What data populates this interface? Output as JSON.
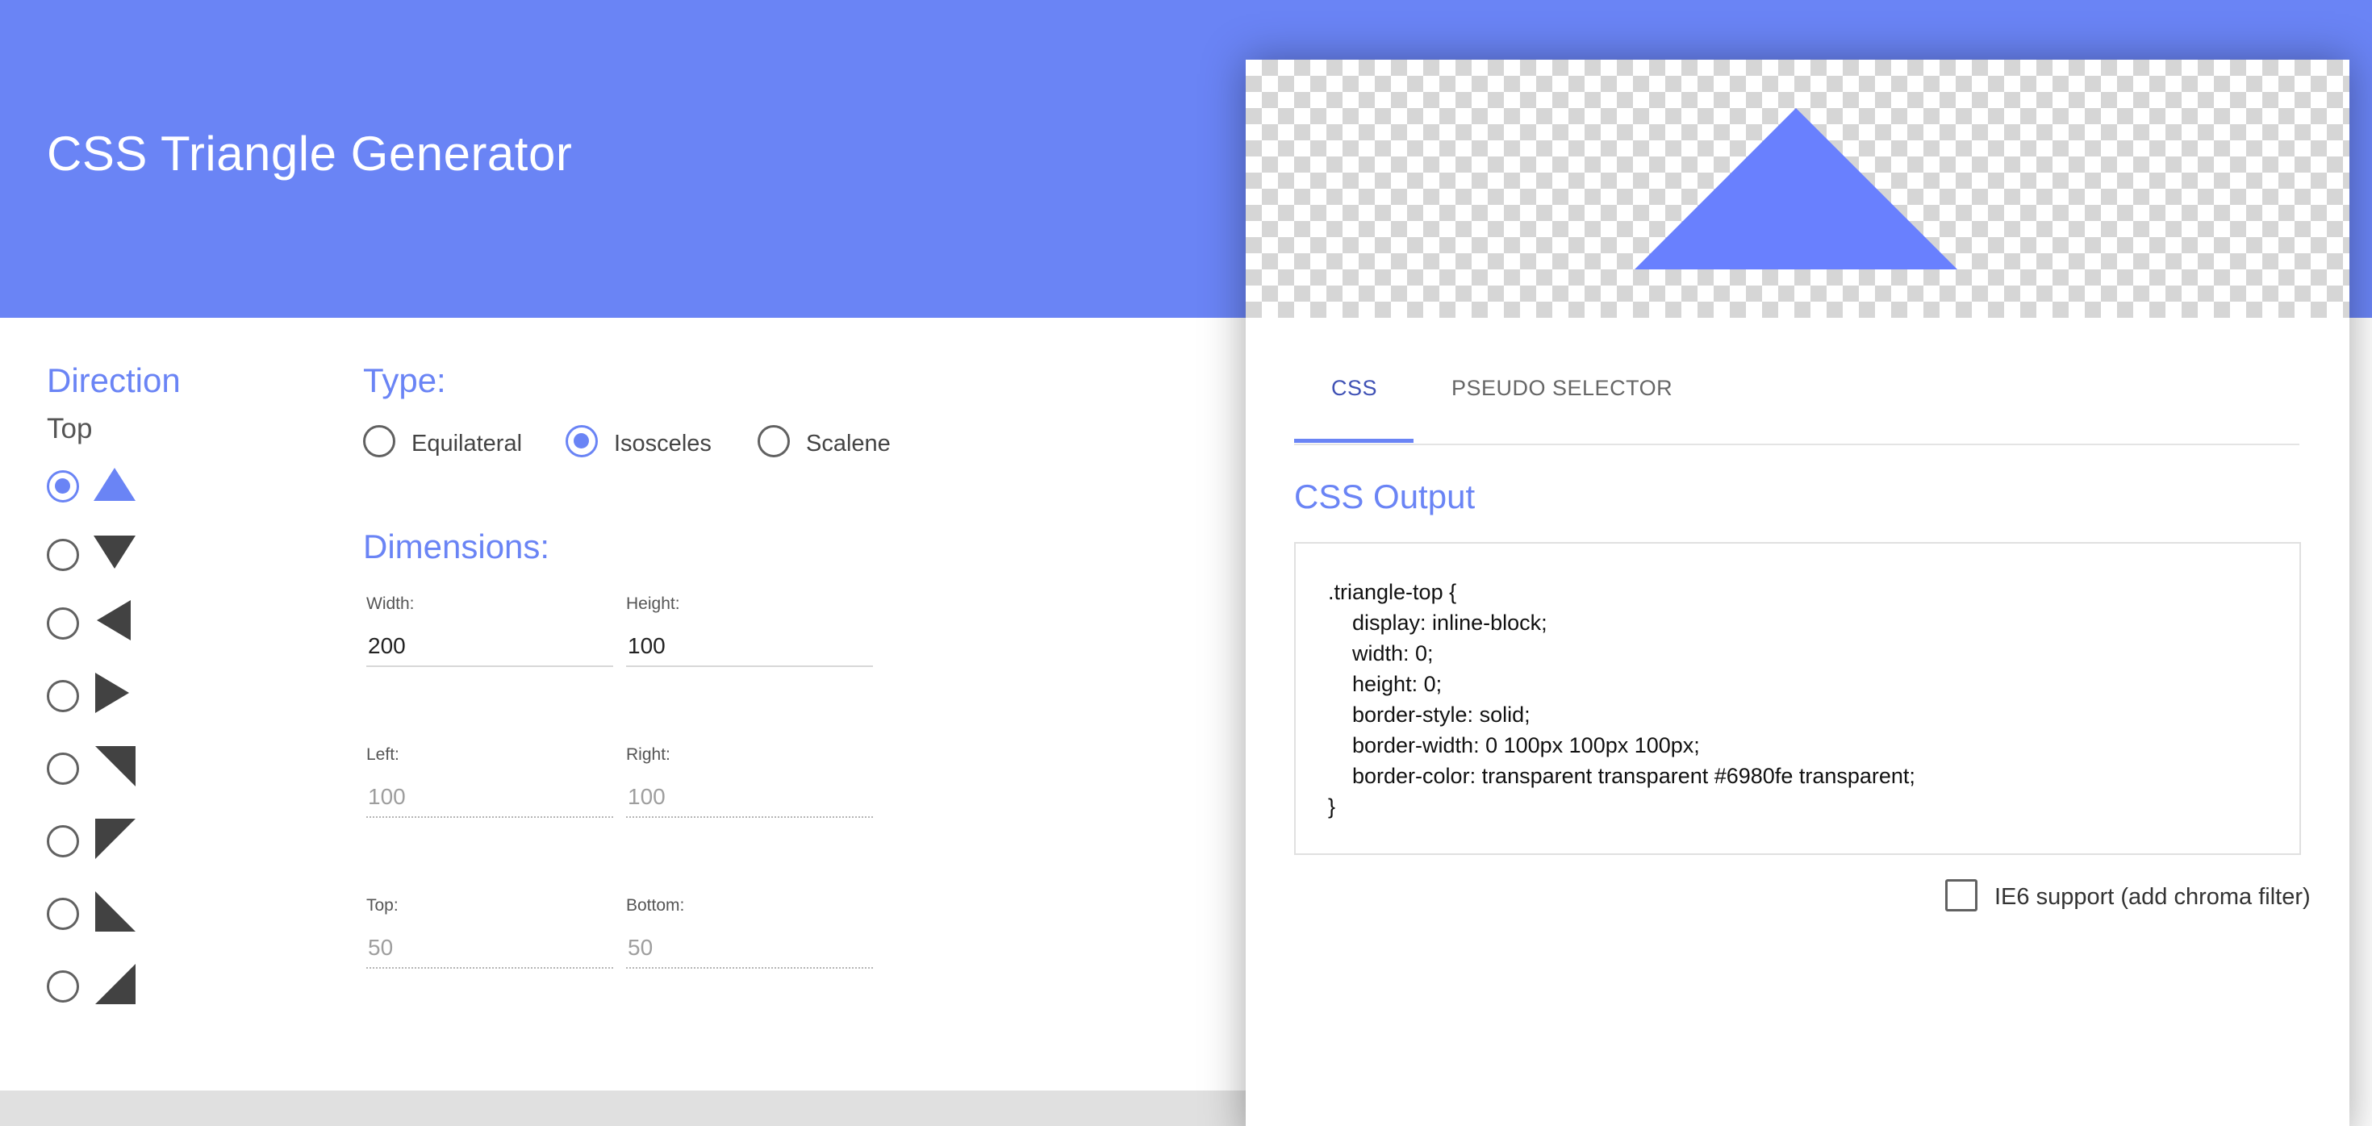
{
  "app": {
    "title": "CSS Triangle Generator",
    "accent_color": "#6a84f5",
    "triangle_color": "#6980fe"
  },
  "direction": {
    "heading": "Direction",
    "selected_value": "Top",
    "options": [
      {
        "name": "top",
        "icon": "triangle-up-icon",
        "selected": true
      },
      {
        "name": "bottom",
        "icon": "triangle-down-icon",
        "selected": false
      },
      {
        "name": "left",
        "icon": "triangle-left-icon",
        "selected": false
      },
      {
        "name": "right",
        "icon": "triangle-right-icon",
        "selected": false
      },
      {
        "name": "top-right",
        "icon": "triangle-top-right-icon",
        "selected": false
      },
      {
        "name": "top-left",
        "icon": "triangle-top-left-icon",
        "selected": false
      },
      {
        "name": "bottom-left",
        "icon": "triangle-bottom-left-icon",
        "selected": false
      },
      {
        "name": "bottom-right",
        "icon": "triangle-bottom-right-icon",
        "selected": false
      }
    ]
  },
  "type": {
    "heading": "Type:",
    "options": [
      {
        "label": "Equilateral",
        "selected": false
      },
      {
        "label": "Isosceles",
        "selected": true
      },
      {
        "label": "Scalene",
        "selected": false
      }
    ]
  },
  "dimensions": {
    "heading": "Dimensions:",
    "width": {
      "label": "Width:",
      "value": "200"
    },
    "height": {
      "label": "Height:",
      "value": "100"
    },
    "left": {
      "label": "Left:",
      "value": "100"
    },
    "right": {
      "label": "Right:",
      "value": "100"
    },
    "top": {
      "label": "Top:",
      "value": "50"
    },
    "bottom": {
      "label": "Bottom:",
      "value": "50"
    }
  },
  "tabs": [
    {
      "label": "CSS",
      "active": true
    },
    {
      "label": "PSEUDO SELECTOR",
      "active": false
    }
  ],
  "output": {
    "heading": "CSS Output",
    "code_lines": [
      ".triangle-top {",
      "    display: inline-block;",
      "    width: 0;",
      "    height: 0;",
      "    border-style: solid;",
      "    border-width: 0 100px 100px 100px;",
      "    border-color: transparent transparent #6980fe transparent;",
      "}"
    ]
  },
  "ie6": {
    "label": "IE6 support (add chroma filter)",
    "checked": false
  }
}
